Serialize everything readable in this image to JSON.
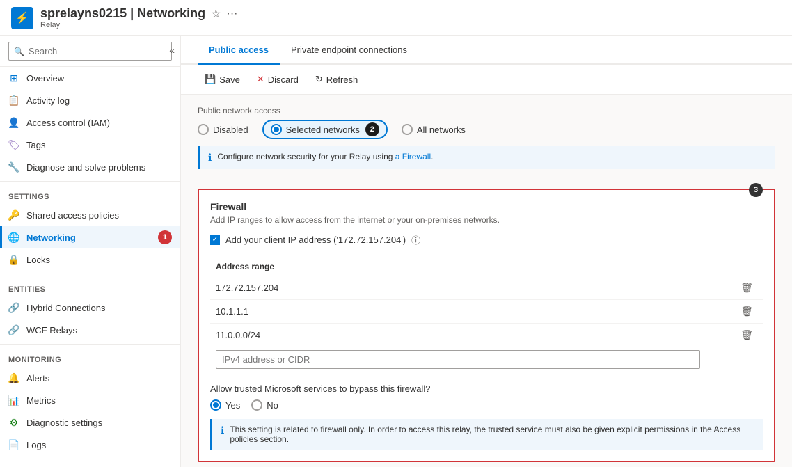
{
  "header": {
    "icon": "⚡",
    "title": "sprelayns0215 | Networking",
    "subtitle": "Relay",
    "favorite_label": "☆",
    "more_label": "···"
  },
  "sidebar": {
    "search_placeholder": "Search",
    "collapse_label": "«",
    "items": [
      {
        "id": "overview",
        "label": "Overview",
        "icon": "⊞",
        "icon_color": "ico-blue"
      },
      {
        "id": "activity-log",
        "label": "Activity log",
        "icon": "📋",
        "icon_color": "ico-blue"
      },
      {
        "id": "access-control",
        "label": "Access control (IAM)",
        "icon": "👤",
        "icon_color": "ico-blue"
      },
      {
        "id": "tags",
        "label": "Tags",
        "icon": "🏷",
        "icon_color": "ico-purple"
      },
      {
        "id": "diagnose",
        "label": "Diagnose and solve problems",
        "icon": "🔧",
        "icon_color": "ico-blue"
      }
    ],
    "settings_label": "Settings",
    "settings_items": [
      {
        "id": "shared-access",
        "label": "Shared access policies",
        "icon": "🔑",
        "icon_color": "ico-yellow"
      },
      {
        "id": "networking",
        "label": "Networking",
        "icon": "🌐",
        "icon_color": "ico-teal",
        "active": true,
        "badge": "1"
      }
    ],
    "locks_item": {
      "id": "locks",
      "label": "Locks",
      "icon": "🔒",
      "icon_color": "ico-blue"
    },
    "entities_label": "Entities",
    "entities_items": [
      {
        "id": "hybrid-connections",
        "label": "Hybrid Connections",
        "icon": "🔗",
        "icon_color": "ico-teal"
      },
      {
        "id": "wcf-relays",
        "label": "WCF Relays",
        "icon": "🔗",
        "icon_color": "ico-teal"
      }
    ],
    "monitoring_label": "Monitoring",
    "monitoring_items": [
      {
        "id": "alerts",
        "label": "Alerts",
        "icon": "🔔",
        "icon_color": "ico-green"
      },
      {
        "id": "metrics",
        "label": "Metrics",
        "icon": "📊",
        "icon_color": "ico-green"
      },
      {
        "id": "diagnostic-settings",
        "label": "Diagnostic settings",
        "icon": "⚙",
        "icon_color": "ico-green"
      },
      {
        "id": "logs",
        "label": "Logs",
        "icon": "📄",
        "icon_color": "ico-green"
      }
    ]
  },
  "tabs": [
    {
      "id": "public-access",
      "label": "Public access",
      "active": true
    },
    {
      "id": "private-endpoint",
      "label": "Private endpoint connections",
      "active": false
    }
  ],
  "toolbar": {
    "save_label": "Save",
    "discard_label": "Discard",
    "refresh_label": "Refresh"
  },
  "public_access": {
    "network_access_label": "Public network access",
    "disabled_label": "Disabled",
    "selected_networks_label": "Selected networks",
    "all_networks_label": "All networks",
    "info_text": "Configure network security for your Relay using a Firewall.",
    "info_link": "a Firewall",
    "step_badge_2": "2"
  },
  "firewall": {
    "title": "Firewall",
    "description": "Add IP ranges to allow access from the internet or your on-premises networks.",
    "checkbox_label": "Add your client IP address ('172.72.157.204')",
    "address_range_label": "Address range",
    "step_badge_3": "3",
    "ip_entries": [
      {
        "ip": "172.72.157.204"
      },
      {
        "ip": "10.1.1.1"
      },
      {
        "ip": "11.0.0.0/24"
      }
    ],
    "ip_input_placeholder": "IPv4 address or CIDR",
    "bypass_title": "Allow trusted Microsoft services to bypass this firewall?",
    "yes_label": "Yes",
    "no_label": "No",
    "warning_text": "This setting is related to firewall only. In order to access this relay, the trusted service must also be given explicit permissions in the Access policies section."
  }
}
